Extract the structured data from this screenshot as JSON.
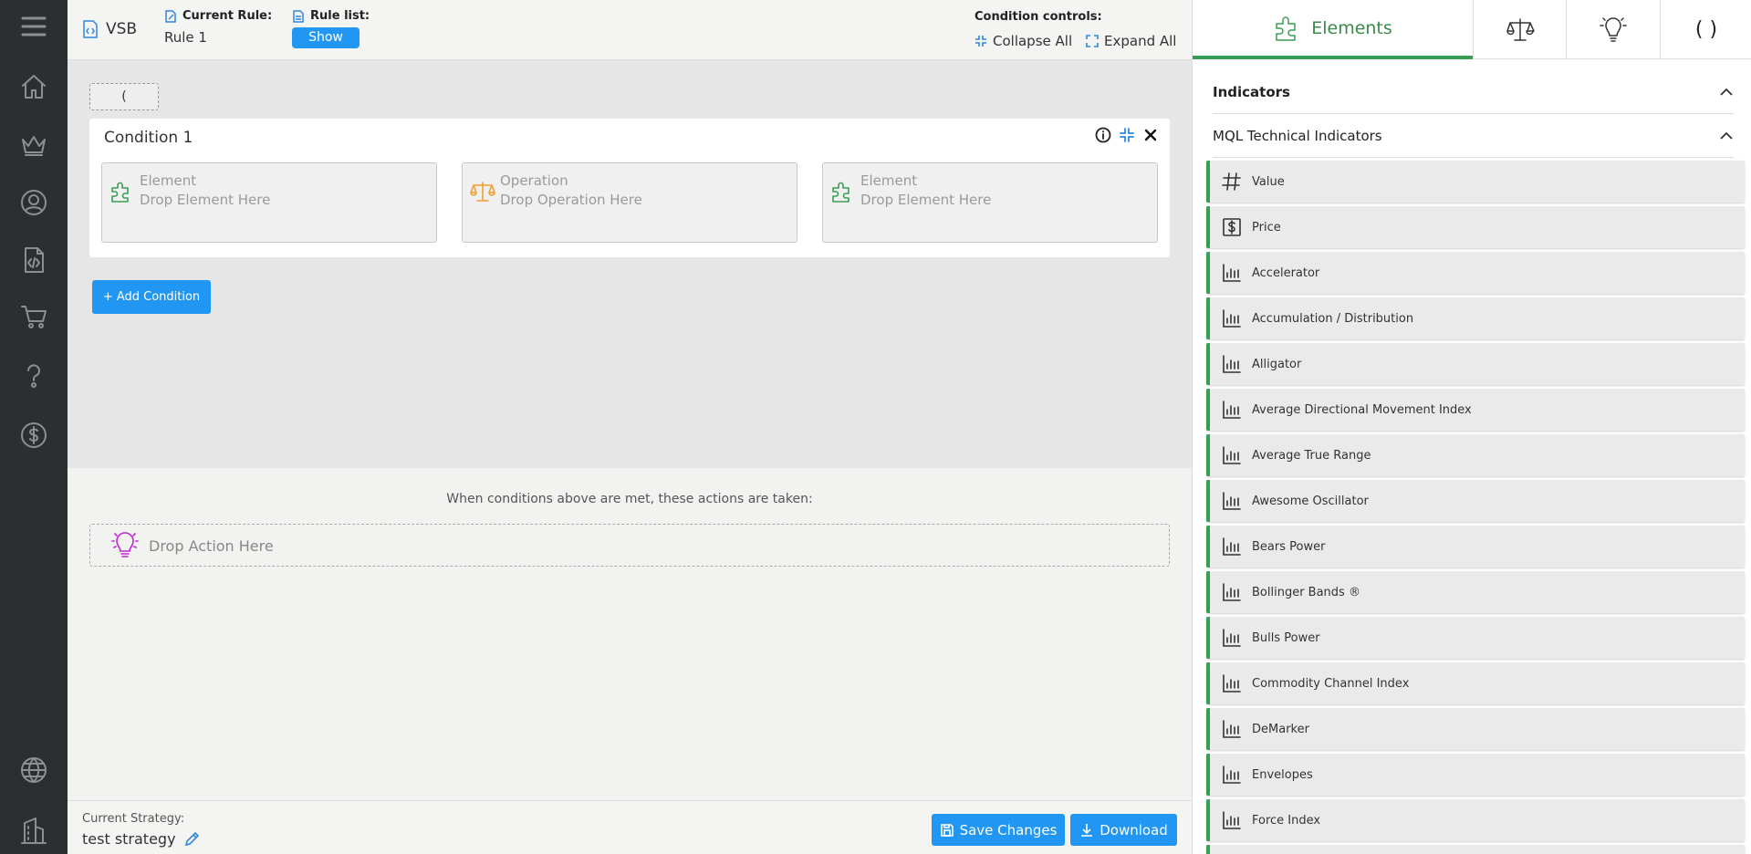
{
  "topbar": {
    "logo": "VSB",
    "current_rule_label": "Current Rule:",
    "current_rule_value": "Rule 1",
    "rule_list_label": "Rule list:",
    "show_button": "Show",
    "condition_controls_label": "Condition controls:",
    "collapse_all": "Collapse All",
    "expand_all": "Expand All"
  },
  "condition_area": {
    "paren": "(",
    "condition_title": "Condition 1",
    "slots": [
      {
        "type": "Element",
        "placeholder": "Drop Element Here"
      },
      {
        "type": "Operation",
        "placeholder": "Drop Operation Here"
      },
      {
        "type": "Element",
        "placeholder": "Drop Element Here"
      }
    ],
    "add_condition": "+ Add Condition"
  },
  "actions": {
    "text": "When conditions above are met, these actions are taken:",
    "drop_placeholder": "Drop Action Here"
  },
  "footer": {
    "current_strategy_label": "Current Strategy:",
    "strategy_name": "test strategy",
    "save_changes": "Save Changes",
    "download": "Download"
  },
  "right_panel": {
    "tabs": [
      {
        "label": "Elements",
        "icon": "puzzle-icon",
        "active": true
      },
      {
        "label": "",
        "icon": "scales-icon"
      },
      {
        "label": "",
        "icon": "lightbulb-icon"
      },
      {
        "label": "( )",
        "icon": "parentheses"
      }
    ],
    "indicators_heading": "Indicators",
    "mql_heading": "MQL Technical Indicators",
    "items": [
      {
        "label": "Value",
        "icon": "hash-icon"
      },
      {
        "label": "Price",
        "icon": "dollar-box-icon"
      },
      {
        "label": "Accelerator",
        "icon": "bar-chart-icon"
      },
      {
        "label": "Accumulation / Distribution",
        "icon": "bar-chart-icon"
      },
      {
        "label": "Alligator",
        "icon": "bar-chart-icon"
      },
      {
        "label": "Average Directional Movement Index",
        "icon": "bar-chart-icon"
      },
      {
        "label": "Average True Range",
        "icon": "bar-chart-icon"
      },
      {
        "label": "Awesome Oscillator",
        "icon": "bar-chart-icon"
      },
      {
        "label": "Bears Power",
        "icon": "bar-chart-icon"
      },
      {
        "label": "Bollinger Bands ®",
        "icon": "bar-chart-icon"
      },
      {
        "label": "Bulls Power",
        "icon": "bar-chart-icon"
      },
      {
        "label": "Commodity Channel Index",
        "icon": "bar-chart-icon"
      },
      {
        "label": "DeMarker",
        "icon": "bar-chart-icon"
      },
      {
        "label": "Envelopes",
        "icon": "bar-chart-icon"
      },
      {
        "label": "Force Index",
        "icon": "bar-chart-icon"
      },
      {
        "label": "",
        "icon": "bar-chart-icon"
      }
    ]
  },
  "colors": {
    "accent_blue": "#2196f3",
    "accent_green": "#3a9d54",
    "operation_orange": "#f0a030",
    "action_magenta": "#c026d3",
    "rail_dark": "#2c2f31"
  }
}
